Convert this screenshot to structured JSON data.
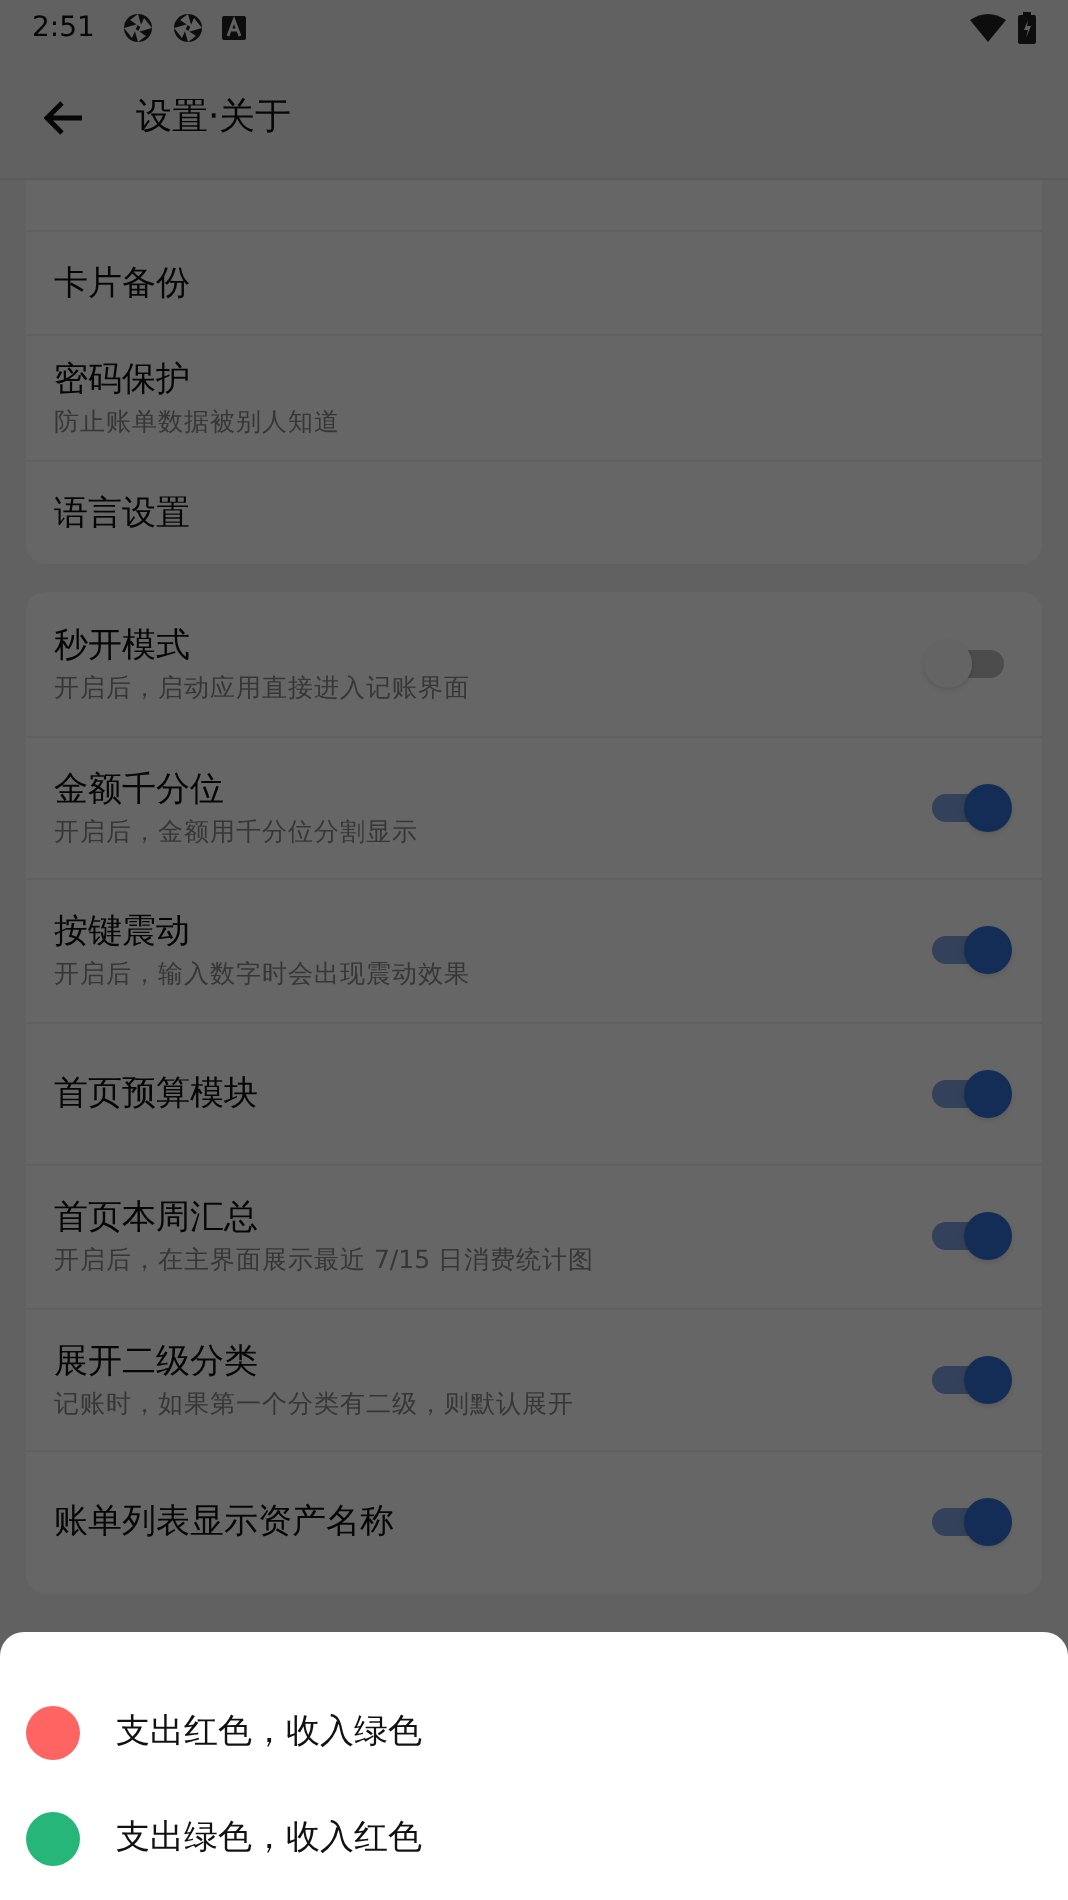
{
  "status_bar": {
    "time": "2:51"
  },
  "header": {
    "title": "设置·关于"
  },
  "general_items": [
    {
      "title": "卡片备份"
    },
    {
      "title": "密码保护",
      "subtitle": "防止账单数据被别人知道"
    },
    {
      "title": "语言设置"
    }
  ],
  "toggle_items": [
    {
      "title": "秒开模式",
      "subtitle": "开启后，启动应用直接进入记账界面",
      "on": false
    },
    {
      "title": "金额千分位",
      "subtitle": "开启后，金额用千分位分割显示",
      "on": true
    },
    {
      "title": "按键震动",
      "subtitle": "开启后，输入数字时会出现震动效果",
      "on": true
    },
    {
      "title": "首页预算模块",
      "on": true
    },
    {
      "title": "首页本周汇总",
      "subtitle": "开启后，在主界面展示最近 7/15 日消费统计图",
      "on": true
    },
    {
      "title": "展开二级分类",
      "subtitle": "记账时，如果第一个分类有二级，则默认展开",
      "on": true
    },
    {
      "title": "账单列表显示资产名称",
      "on": true
    }
  ],
  "color_sheet": {
    "options": [
      {
        "label": "支出红色，收入绿色",
        "color": "#fe6461"
      },
      {
        "label": "支出绿色，收入红色",
        "color": "#26b67a"
      }
    ]
  }
}
